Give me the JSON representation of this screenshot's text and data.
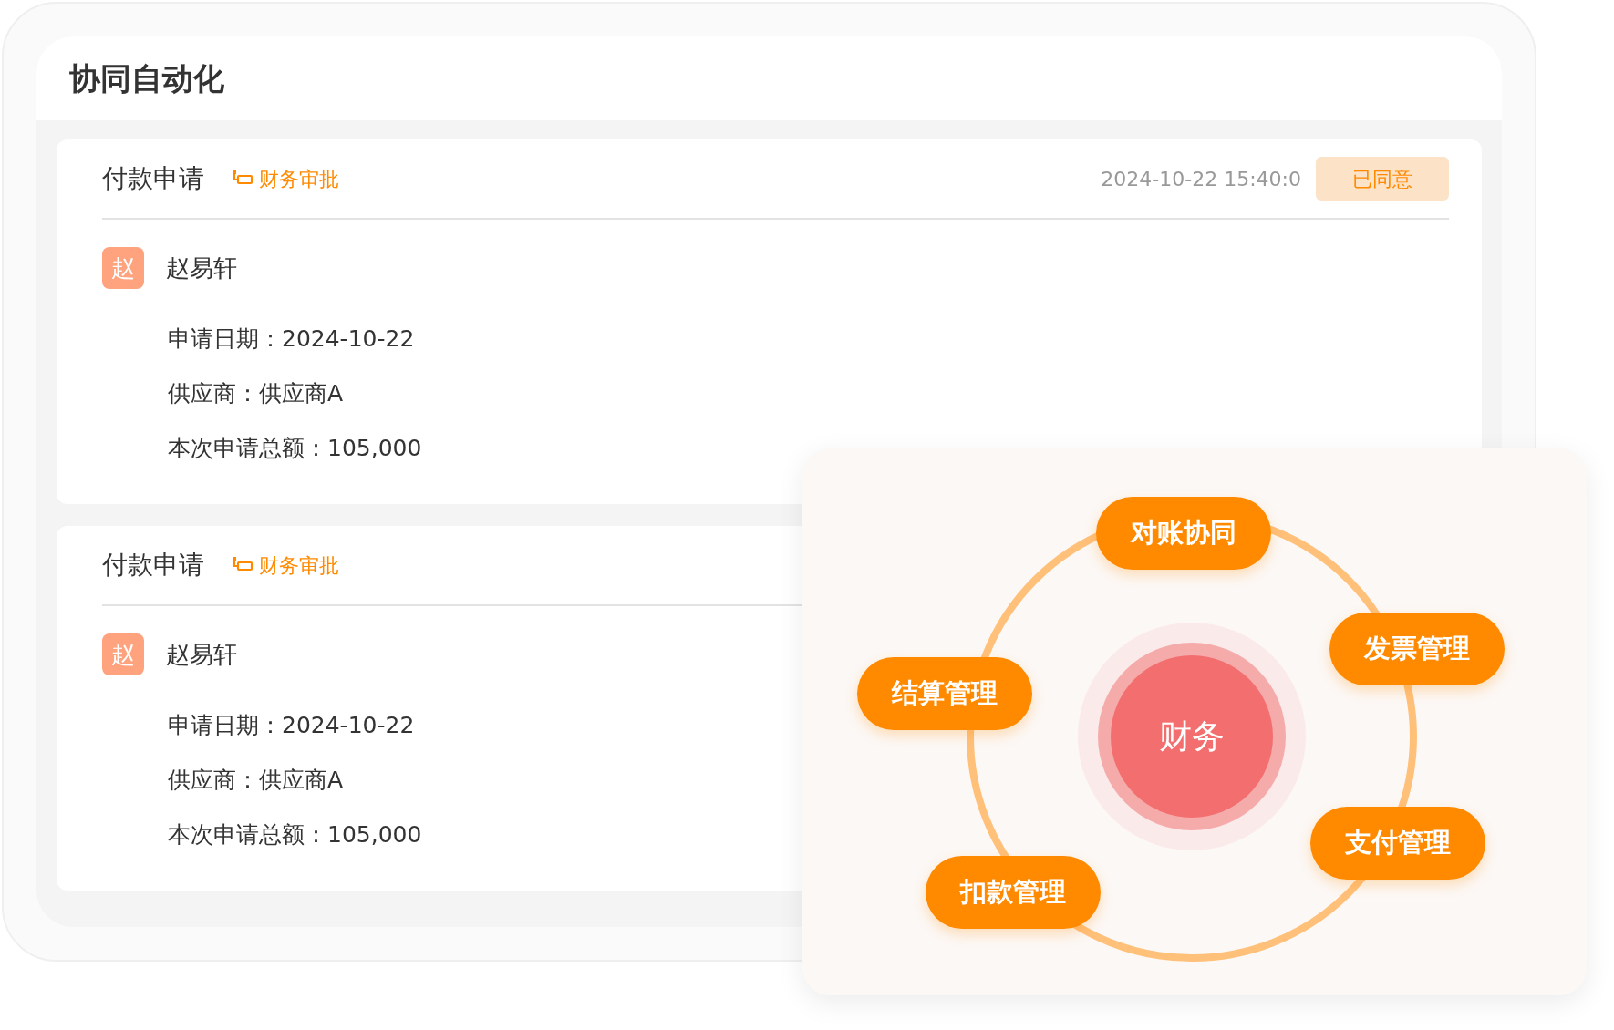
{
  "panel": {
    "title": "协同自动化"
  },
  "cards": [
    {
      "title": "付款申请",
      "tag": "财务审批",
      "timestamp": "2024-10-22 15:40:0",
      "status": "已同意",
      "applicant": {
        "avatar": "赵",
        "name": "赵易轩"
      },
      "fields": [
        {
          "label": "申请日期：",
          "value": "2024-10-22"
        },
        {
          "label": "供应商：",
          "value": "供应商A"
        },
        {
          "label": "本次申请总额：",
          "value": "105,000"
        }
      ]
    },
    {
      "title": "付款申请",
      "tag": "财务审批",
      "applicant": {
        "avatar": "赵",
        "name": "赵易轩"
      },
      "fields": [
        {
          "label": "申请日期：",
          "value": "2024-10-22"
        },
        {
          "label": "供应商：",
          "value": "供应商A"
        },
        {
          "label": "本次申请总额：",
          "value": "105,000"
        }
      ]
    }
  ],
  "diagram": {
    "center": "财务",
    "nodes": [
      "对账协同",
      "发票管理",
      "结算管理",
      "支付管理",
      "扣款管理"
    ]
  }
}
